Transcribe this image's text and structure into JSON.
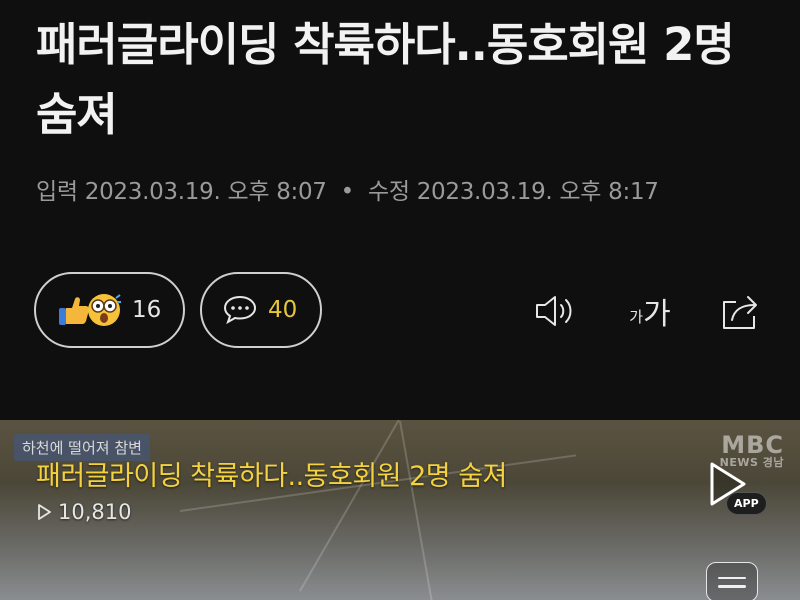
{
  "article": {
    "headline": "패러글라이딩 착륙하다..동호회원 2명 숨져",
    "input_label": "입력",
    "input_time": "2023.03.19. 오후 8:07",
    "separator": "•",
    "modified_label": "수정",
    "modified_time": "2023.03.19. 오후 8:17"
  },
  "reactions": {
    "icons": [
      "thumbs-up-emoji",
      "shocked-face-emoji"
    ],
    "count": "16"
  },
  "comments": {
    "icon": "speech-bubble-icon",
    "count": "40"
  },
  "tools": {
    "speaker_icon": "speaker-icon",
    "font_small": "가",
    "font_large": "가",
    "share_icon": "share-icon"
  },
  "video": {
    "ticker_text": "하천에 떨어져 참변",
    "logo_text": "MBC",
    "logo_sub": "NEWS 경남",
    "title": "패러글라이딩 착륙하다..동호회원 2명 숨져",
    "views": "10,810",
    "app_label": "APP"
  },
  "colors": {
    "background": "#0f0f10",
    "headline": "#f2f2f2",
    "meta": "#9a9a9a",
    "comment_count": "#e8c63a",
    "video_title": "#f4d23f"
  }
}
